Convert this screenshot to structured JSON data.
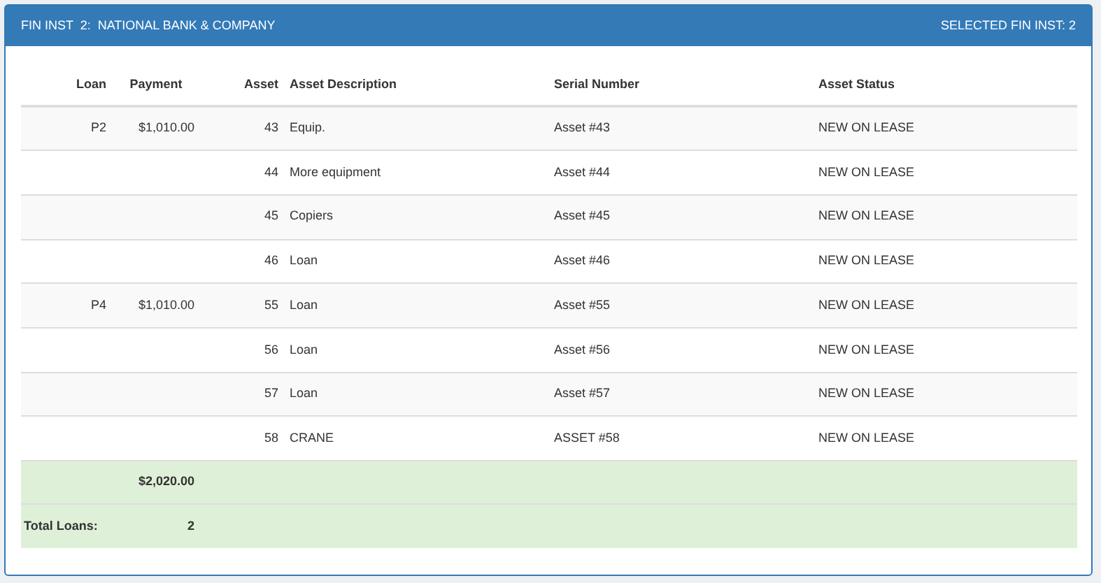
{
  "panel": {
    "title": "FIN INST  2:  NATIONAL BANK & COMPANY",
    "selected_label": "SELECTED FIN INST: 2"
  },
  "table": {
    "columns": [
      "Loan",
      "Payment",
      "Asset",
      "Asset Description",
      "Serial Number",
      "Asset Status"
    ],
    "rows": [
      [
        "P2",
        "$1,010.00",
        "43",
        "Equip.",
        "Asset #43",
        "NEW ON LEASE"
      ],
      [
        "",
        "",
        "44",
        "More equipment",
        "Asset #44",
        "NEW ON LEASE"
      ],
      [
        "",
        "",
        "45",
        "Copiers",
        "Asset #45",
        "NEW ON LEASE"
      ],
      [
        "",
        "",
        "46",
        "Loan",
        "Asset #46",
        "NEW ON LEASE"
      ],
      [
        "P4",
        "$1,010.00",
        "55",
        "Loan",
        "Asset #55",
        "NEW ON LEASE"
      ],
      [
        "",
        "",
        "56",
        "Loan",
        "Asset #56",
        "NEW ON LEASE"
      ],
      [
        "",
        "",
        "57",
        "Loan",
        "Asset #57",
        "NEW ON LEASE"
      ],
      [
        "",
        "",
        "58",
        "CRANE",
        "ASSET #58",
        "NEW ON LEASE"
      ]
    ],
    "totals": {
      "payment_total": "$2,020.00",
      "loans_label": "Total Loans:",
      "loans_count": "2"
    }
  }
}
